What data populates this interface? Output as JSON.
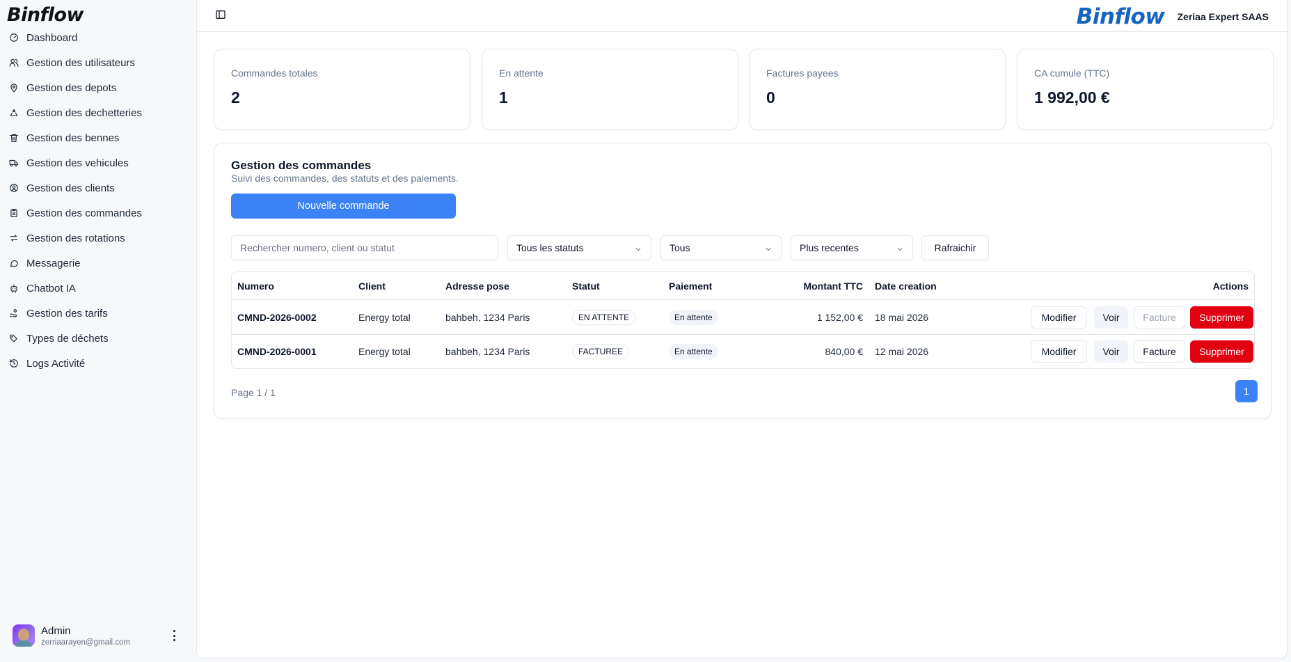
{
  "sidebar": {
    "logo": "Binflow",
    "items": [
      {
        "label": "Dashboard",
        "icon": "gauge-icon"
      },
      {
        "label": "Gestion des utilisateurs",
        "icon": "users-icon"
      },
      {
        "label": "Gestion des depots",
        "icon": "map-pin-icon"
      },
      {
        "label": "Gestion des dechetteries",
        "icon": "recycle-icon"
      },
      {
        "label": "Gestion des bennes",
        "icon": "trash-icon"
      },
      {
        "label": "Gestion des vehicules",
        "icon": "truck-icon"
      },
      {
        "label": "Gestion des clients",
        "icon": "user-circle-icon"
      },
      {
        "label": "Gestion des commandes",
        "icon": "clipboard-icon"
      },
      {
        "label": "Gestion des rotations",
        "icon": "arrows-swap-icon"
      },
      {
        "label": "Messagerie",
        "icon": "message-icon"
      },
      {
        "label": "Chatbot IA",
        "icon": "bot-icon"
      },
      {
        "label": "Gestion des tarifs",
        "icon": "hand-coins-icon"
      },
      {
        "label": "Types de déchets",
        "icon": "tags-icon"
      },
      {
        "label": "Logs Activité",
        "icon": "history-icon"
      }
    ],
    "user": {
      "name": "Admin",
      "email": "zerriaarayen@gmail.com"
    }
  },
  "header": {
    "brand_logo": "Binflow",
    "company": "Zeriaa Expert SAAS"
  },
  "stats": [
    {
      "label": "Commandes totales",
      "value": "2"
    },
    {
      "label": "En attente",
      "value": "1"
    },
    {
      "label": "Factures payees",
      "value": "0"
    },
    {
      "label": "CA cumule (TTC)",
      "value": "1 992,00 €"
    }
  ],
  "orders": {
    "title": "Gestion des commandes",
    "subtitle": "Suivi des commandes, des statuts et des paiements.",
    "new_button": "Nouvelle commande",
    "search_placeholder": "Rechercher numero, client ou statut",
    "filter_status": "Tous les statuts",
    "filter_payment": "Tous",
    "sort": "Plus recentes",
    "refresh_button": "Rafraichir",
    "columns": [
      "Numero",
      "Client",
      "Adresse pose",
      "Statut",
      "Paiement",
      "Montant TTC",
      "Date creation",
      "Actions"
    ],
    "rows": [
      {
        "numero": "CMND-2026-0002",
        "client": "Energy total",
        "adresse": "bahbeh, 1234 Paris",
        "statut": "EN ATTENTE",
        "paiement": "En attente",
        "montant": "1 152,00 €",
        "date": "18 mai 2026",
        "invoice_enabled": false
      },
      {
        "numero": "CMND-2026-0001",
        "client": "Energy total",
        "adresse": "bahbeh, 1234 Paris",
        "statut": "FACTUREE",
        "paiement": "En attente",
        "montant": "840,00 €",
        "date": "12 mai 2026",
        "invoice_enabled": true
      }
    ],
    "actions": {
      "modify": "Modifier",
      "view": "Voir",
      "invoice": "Facture",
      "delete": "Supprimer"
    },
    "pagination": {
      "text": "Page 1 / 1",
      "current": "1"
    }
  },
  "colors": {
    "primary": "#3b82f6",
    "danger": "#e00010",
    "brand": "#1565c0"
  }
}
